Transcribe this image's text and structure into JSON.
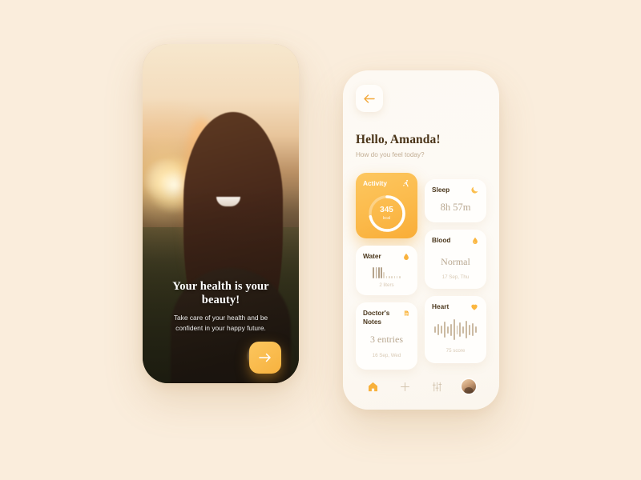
{
  "background_color": "#faeddc",
  "accent_color": "#fbb949",
  "onboarding": {
    "headline": "Your health is your beauty!",
    "subtitle": "Take care of your health and be confident in your happy future.",
    "cta_icon": "arrow-right-icon",
    "photo_alt": "Smiling woman at sunset holding a white flower"
  },
  "dashboard": {
    "back_icon": "arrow-left-icon",
    "greeting": "Hello, Amanda!",
    "greeting_sub": "How do you feel today?",
    "cards": {
      "activity": {
        "title": "Activity",
        "icon": "running-icon",
        "value": "345",
        "unit": "kcal",
        "progress_percent": 72
      },
      "sleep": {
        "title": "Sleep",
        "icon": "moon-icon",
        "value": "8h 57m"
      },
      "blood": {
        "title": "Blood",
        "icon": "blood-drop-icon",
        "value": "Normal",
        "date": "17 Sep, Thu"
      },
      "water": {
        "title": "Water",
        "icon": "water-drop-icon",
        "value": "2 liters",
        "gauge_filled": 4,
        "gauge_total": 11
      },
      "notes": {
        "title": "Doctor's Notes",
        "icon": "notes-icon",
        "value": "3 entries",
        "date": "16 Sep, Wed"
      },
      "heart": {
        "title": "Heart",
        "icon": "heart-icon",
        "value": "75 score",
        "waveform": [
          8,
          14,
          10,
          20,
          9,
          15,
          26,
          11,
          18,
          9,
          22,
          13,
          16,
          8
        ]
      }
    },
    "bottom_nav": [
      {
        "name": "home",
        "icon": "home-icon",
        "active": true
      },
      {
        "name": "add",
        "icon": "plus-icon",
        "active": false
      },
      {
        "name": "settings",
        "icon": "sliders-icon",
        "active": false
      },
      {
        "name": "profile",
        "icon": "avatar-icon",
        "active": false
      }
    ]
  }
}
